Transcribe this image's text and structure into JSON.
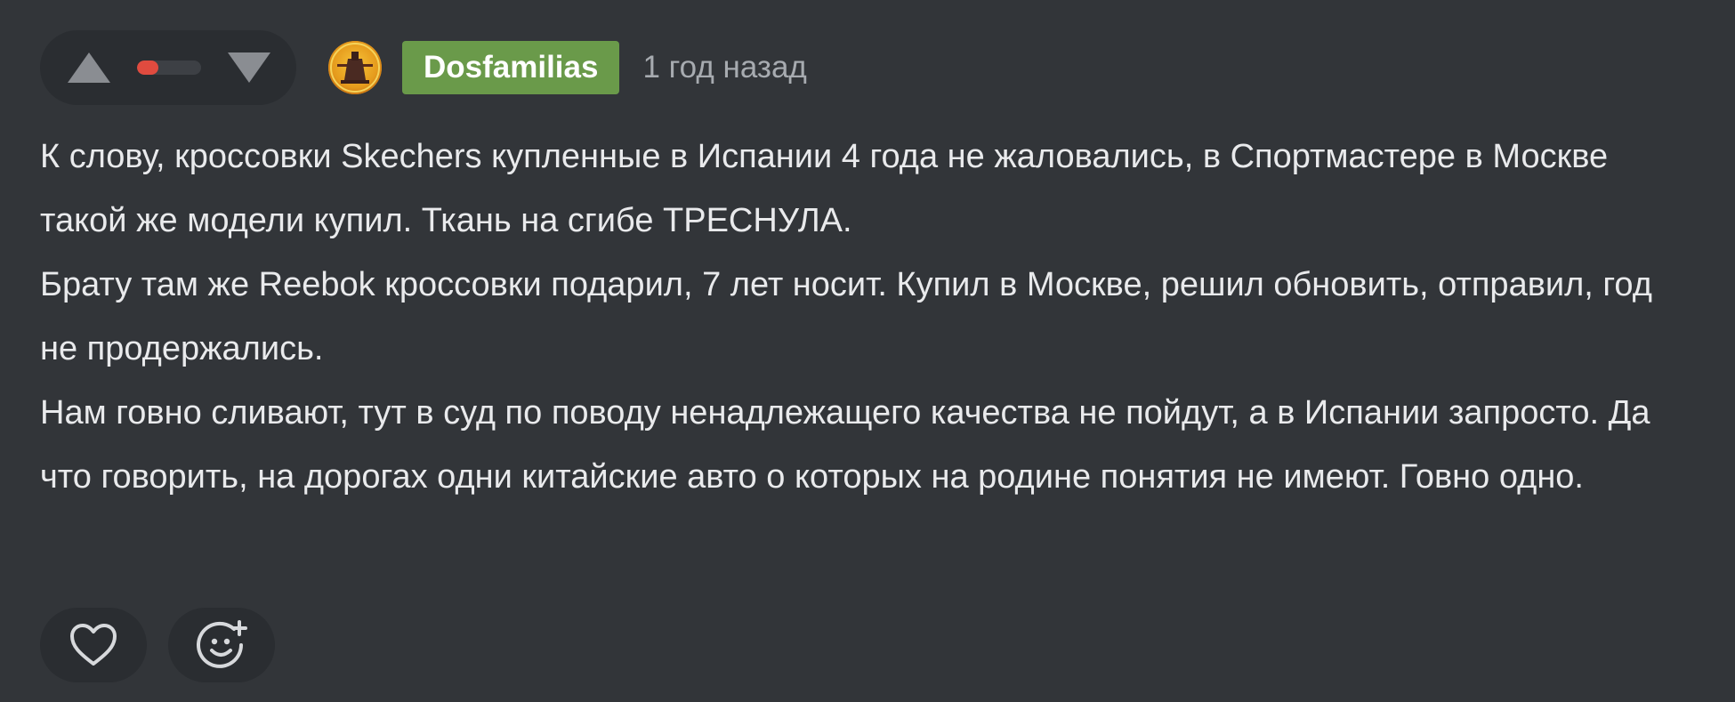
{
  "comment": {
    "author": "Dosfamilias",
    "timestamp": "1 год назад",
    "rating_negative_fraction": 0.33,
    "colors": {
      "username_badge": "#6a9a4a",
      "rating_negative": "#e04b3f",
      "background": "#323539"
    },
    "icons": {
      "upvote": "triangle-up-icon",
      "downvote": "triangle-down-icon",
      "like": "heart-icon",
      "reaction": "smiley-plus-icon"
    },
    "paragraphs": [
      "К слову, кроссовки Skechers купленные в Испании 4 года не жаловались, в Спортмастере в Москве такой же модели купил. Ткань на сгибе ТРЕСНУЛА.",
      "Брату там же Reebok кроссовки подарил, 7 лет носит. Купил в Москве, решил обновить, отправил, год не продержались.",
      "Нам говно сливают, тут в суд по поводу ненадлежащего качества не пойдут, а в Испании запросто. Да что говорить, на дорогах одни китайские авто о которых на родине понятия не имеют. Говно одно."
    ]
  }
}
